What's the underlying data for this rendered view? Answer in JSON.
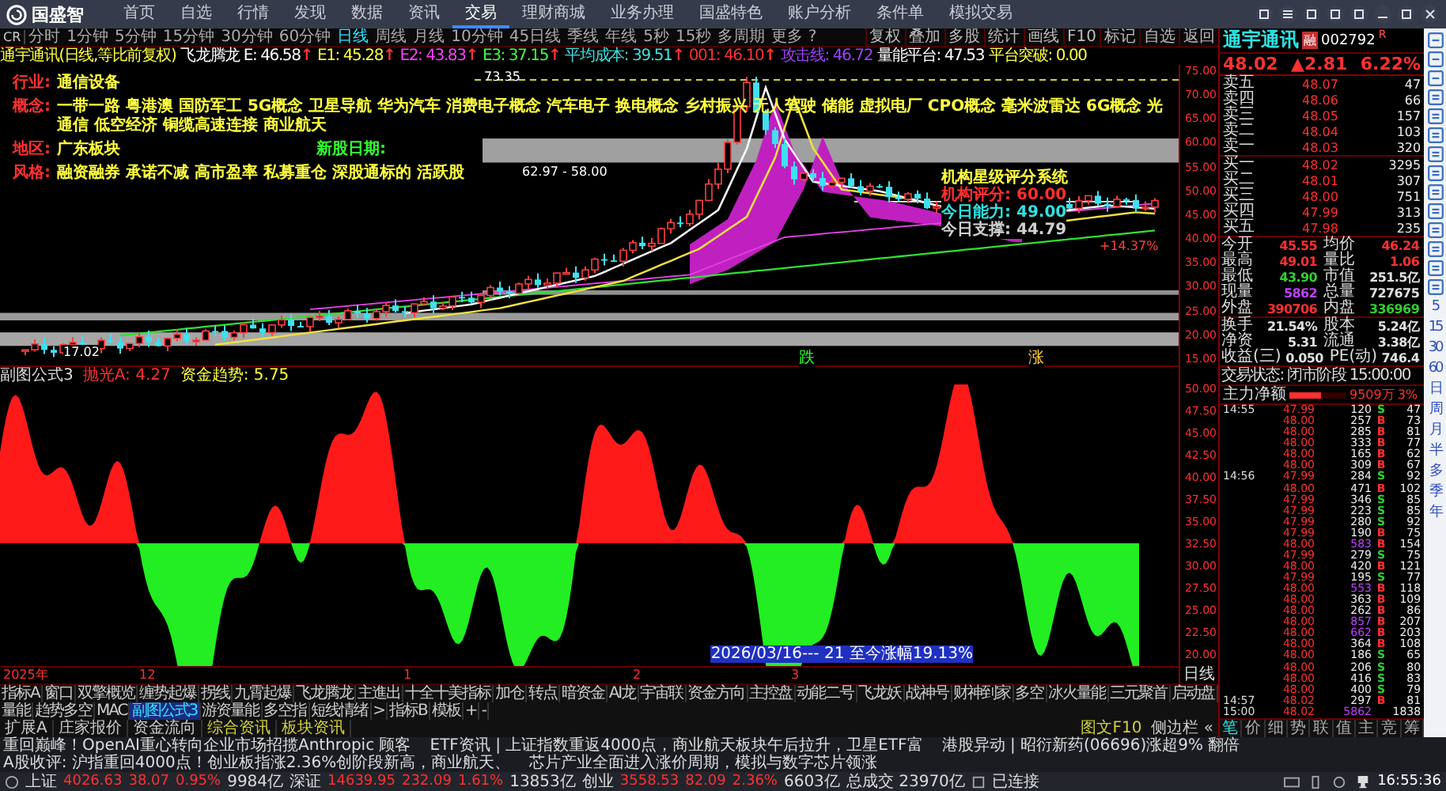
{
  "app": {
    "logo": "国盛智",
    "menu": [
      {
        "label": "首页",
        "selected": false
      },
      {
        "label": "自选",
        "selected": false
      },
      {
        "label": "行情",
        "selected": false
      },
      {
        "label": "发现",
        "selected": false
      },
      {
        "label": "数据",
        "selected": false
      },
      {
        "label": "资讯",
        "selected": false
      },
      {
        "label": "交易",
        "selected": true
      },
      {
        "label": "理财商城",
        "selected": false
      },
      {
        "label": "业务办理",
        "selected": false
      },
      {
        "label": "国盛特色",
        "selected": false
      },
      {
        "label": "账户分析",
        "selected": false
      },
      {
        "label": "条件单",
        "selected": false
      },
      {
        "label": "模拟交易",
        "selected": false
      }
    ]
  },
  "period_bar": {
    "prefix": "CR",
    "periods": [
      {
        "label": "分时",
        "selected": false
      },
      {
        "label": "1分钟",
        "selected": false
      },
      {
        "label": "5分钟",
        "selected": false
      },
      {
        "label": "15分钟",
        "selected": false
      },
      {
        "label": "30分钟",
        "selected": false
      },
      {
        "label": "60分钟",
        "selected": false
      },
      {
        "label": "日线",
        "selected": true
      },
      {
        "label": "周线",
        "selected": false
      },
      {
        "label": "月线",
        "selected": false
      },
      {
        "label": "10分钟",
        "selected": false
      },
      {
        "label": "45日线",
        "selected": false
      },
      {
        "label": "季线",
        "selected": false
      },
      {
        "label": "年线",
        "selected": false
      },
      {
        "label": "5秒",
        "selected": false
      },
      {
        "label": "15秒",
        "selected": false
      },
      {
        "label": "多周期",
        "selected": false
      },
      {
        "label": "更多 ?",
        "selected": false
      }
    ],
    "tools": [
      "复权",
      "叠加",
      "多股",
      "统计",
      "画线",
      "F10",
      "标记",
      "自选",
      "返回"
    ]
  },
  "indicator_bar": {
    "title": "通宇通讯(日线,等比前复权)",
    "items": [
      {
        "text": "飞龙腾龙 E: 46.58",
        "color": "#ffffff",
        "arrow": "↑"
      },
      {
        "text": "E1: 45.28",
        "color": "#ffff40",
        "arrow": "↑"
      },
      {
        "text": "E2: 43.83",
        "color": "#ff40ff",
        "arrow": "↑"
      },
      {
        "text": "E3: 37.15",
        "color": "#40ff40",
        "arrow": "↑"
      },
      {
        "text": "平均成本: 39.51",
        "color": "#40e0e0",
        "arrow": "↑"
      },
      {
        "text": "001: 46.10",
        "color": "#ff3030",
        "arrow": "↑"
      },
      {
        "text": "攻击线: 46.72",
        "color": "#a040ff"
      },
      {
        "text": "量能平台: 47.53",
        "color": "#ffffff"
      },
      {
        "text": "平台突破: 0.00",
        "color": "#ffff40"
      }
    ]
  },
  "info_lines": [
    {
      "label": "行业:",
      "value": "通信设备"
    },
    {
      "label": "概念:",
      "value": "一带一路 粤港澳 国防军工 5G概念 卫星导航 华为汽车 消费电子概念 汽车电子 换电概念 乡村振兴 无人驾驶 储能 虚拟电厂 CPO概念 毫米波雷达 6G概念 光通信 低空经济 铜缆高速连接 商业航天"
    },
    {
      "label": "地区:",
      "value": "广东板块",
      "extra": "新股日期:"
    },
    {
      "label": "风格:",
      "value": "融资融券 承诺不减 高市盈率 私募重仓 深股通标的 活跃股"
    }
  ],
  "rating_box": {
    "title": "机构星级评分系统",
    "lines": [
      {
        "text": "机构评分: 60.00",
        "color": "#ff3030"
      },
      {
        "text": "今日能力: 49.00",
        "color": "#30e0e0"
      },
      {
        "text": "今日支撑: 44.79",
        "color": "#d0d0d0"
      }
    ]
  },
  "chart_labels": {
    "peak": "73.35",
    "range": "62.97 - 58.00",
    "low": "17.02",
    "gain": "+14.37%",
    "fall": "跌",
    "rise": "涨"
  },
  "main_axis": [
    "75.00",
    "70.00",
    "65.00",
    "60.00",
    "55.00",
    "50.00",
    "45.00",
    "40.00",
    "35.00",
    "30.00",
    "25.00",
    "20.00",
    "15.00"
  ],
  "sub_chart": {
    "title": "副图公式3",
    "items": [
      {
        "text": "抛光A: 4.27",
        "color": "#ff3030"
      },
      {
        "text": "资金趋势: 5.75",
        "color": "#ffff40"
      }
    ]
  },
  "sub_axis": [
    "50.00",
    "47.50",
    "45.00",
    "42.50",
    "40.00",
    "37.50",
    "35.00",
    "32.50",
    "30.00",
    "27.50",
    "25.00",
    "22.50",
    "20.00"
  ],
  "axis_period": "日线",
  "time_axis": [
    "2025年",
    "12",
    "1",
    "2",
    "3"
  ],
  "range_note": "2026/03/16--- 21 至今涨幅19.13%",
  "indicator_tabs": [
    {
      "label": "指标A",
      "selected": false
    },
    {
      "label": "窗口",
      "selected": false
    },
    {
      "label": "双擎概览",
      "selected": false
    },
    {
      "label": "缠势起爆",
      "selected": false
    },
    {
      "label": "拐线",
      "selected": false
    },
    {
      "label": "九霄起爆",
      "selected": false
    },
    {
      "label": "飞龙腾龙",
      "selected": false
    },
    {
      "label": "主進出",
      "selected": false
    },
    {
      "label": "十全十美指标",
      "selected": false
    },
    {
      "label": "加仓",
      "selected": false
    },
    {
      "label": "转点",
      "selected": false
    },
    {
      "label": "暗资金",
      "selected": false
    },
    {
      "label": "AI龙",
      "selected": false
    },
    {
      "label": "宇宙联",
      "selected": false
    },
    {
      "label": "资金方向",
      "selected": false
    },
    {
      "label": "主控盘",
      "selected": false
    },
    {
      "label": "动能二号",
      "selected": false
    },
    {
      "label": "飞龙妖",
      "selected": false
    },
    {
      "label": "战神号",
      "selected": false
    },
    {
      "label": "财神到家",
      "selected": false
    },
    {
      "label": "多空",
      "selected": false
    },
    {
      "label": "冰火量能",
      "selected": false
    },
    {
      "label": "三元聚首",
      "selected": false
    },
    {
      "label": "启动盘",
      "selected": false
    },
    {
      "label": "量能",
      "selected": false
    },
    {
      "label": "趋势多空",
      "selected": false
    },
    {
      "label": "MAC",
      "selected": false
    },
    {
      "label": "副图公式3",
      "selected": true
    },
    {
      "label": "游资量能",
      "selected": false
    },
    {
      "label": "多空指",
      "selected": false
    },
    {
      "label": "短线情绪",
      "selected": false
    },
    {
      "label": ">",
      "selected": false
    },
    {
      "label": "指标B",
      "selected": false
    },
    {
      "label": "模板",
      "selected": false
    },
    {
      "label": "+",
      "selected": false
    },
    {
      "label": "-",
      "selected": false
    }
  ],
  "extra_tabs": [
    {
      "label": "扩展A",
      "highlight": false
    },
    {
      "label": "庄家报价",
      "highlight": false
    },
    {
      "label": "资金流向",
      "highlight": false
    },
    {
      "label": "综合资讯",
      "highlight": true
    },
    {
      "label": "板块资讯",
      "highlight": true
    }
  ],
  "side_links": [
    "图文F10",
    "侧边栏 «"
  ],
  "quote": {
    "name": "通宇通讯",
    "badge": "融",
    "code": "002792",
    "mark": "R",
    "price": "48.02",
    "change": "▲2.81",
    "pct": "6.22%",
    "asks": [
      {
        "label": "卖五",
        "price": "48.07",
        "volume": "47"
      },
      {
        "label": "卖四",
        "price": "48.06",
        "volume": "66"
      },
      {
        "label": "卖三",
        "price": "48.05",
        "volume": "157"
      },
      {
        "label": "卖二",
        "price": "48.04",
        "volume": "103"
      },
      {
        "label": "卖一",
        "price": "48.03",
        "volume": "320"
      }
    ],
    "bids": [
      {
        "label": "买一",
        "price": "48.02",
        "volume": "3295"
      },
      {
        "label": "买二",
        "price": "48.01",
        "volume": "307"
      },
      {
        "label": "买三",
        "price": "48.00",
        "volume": "751"
      },
      {
        "label": "买四",
        "price": "47.99",
        "volume": "313"
      },
      {
        "label": "买五",
        "price": "47.98",
        "volume": "235"
      }
    ],
    "stats": [
      [
        {
          "label": "今开",
          "value": "45.55",
          "color": "#ff3030"
        },
        {
          "label": "均价",
          "value": "46.24",
          "color": "#ff3030"
        }
      ],
      [
        {
          "label": "最高",
          "value": "49.01",
          "color": "#ff3030"
        },
        {
          "label": "量比",
          "value": "1.06",
          "color": "#ff3030"
        }
      ],
      [
        {
          "label": "最低",
          "value": "43.90",
          "color": "#30d030"
        },
        {
          "label": "市值",
          "value": "251.5亿",
          "color": "#e0e0e0"
        }
      ],
      [
        {
          "label": "现量",
          "value": "5862",
          "color": "#c040ff"
        },
        {
          "label": "总量",
          "value": "727675",
          "color": "#e0e0e0"
        }
      ],
      [
        {
          "label": "外盘",
          "value": "390706",
          "color": "#ff3030"
        },
        {
          "label": "内盘",
          "value": "336969",
          "color": "#30d030"
        }
      ]
    ],
    "stats2": [
      [
        {
          "label": "换手",
          "value": "21.54%",
          "color": "#e0e0e0"
        },
        {
          "label": "股本",
          "value": "5.24亿",
          "color": "#e0e0e0"
        }
      ],
      [
        {
          "label": "净资",
          "value": "5.31",
          "color": "#e0e0e0"
        },
        {
          "label": "流通",
          "value": "3.38亿",
          "color": "#e0e0e0"
        }
      ],
      [
        {
          "label": "收益(三)",
          "value": "0.050",
          "color": "#e0e0e0"
        },
        {
          "label": "PE(动)",
          "value": "746.4",
          "color": "#e0e0e0"
        }
      ]
    ],
    "state": "交易状态: 闭市阶段 15:00:00",
    "net": {
      "label": "主力净额",
      "amount": "9509万",
      "pct": "3%",
      "level": 0.55
    }
  },
  "ticks": [
    {
      "time": "14:55",
      "price": "47.99",
      "volume": "120",
      "side": "S",
      "count": "47",
      "kind": "sell",
      "big": false
    },
    {
      "price": "48.00",
      "volume": "257",
      "side": "B",
      "count": "73",
      "kind": "buy",
      "big": false
    },
    {
      "price": "48.00",
      "volume": "285",
      "side": "B",
      "count": "81",
      "kind": "buy",
      "big": false
    },
    {
      "price": "48.00",
      "volume": "333",
      "side": "B",
      "count": "77",
      "kind": "buy",
      "big": false
    },
    {
      "price": "48.00",
      "volume": "165",
      "side": "B",
      "count": "62",
      "kind": "buy",
      "big": false
    },
    {
      "price": "48.00",
      "volume": "309",
      "side": "B",
      "count": "67",
      "kind": "buy",
      "big": false
    },
    {
      "time": "14:56",
      "price": "47.99",
      "volume": "284",
      "side": "S",
      "count": "92",
      "kind": "sell",
      "big": false
    },
    {
      "price": "48.00",
      "volume": "471",
      "side": "B",
      "count": "102",
      "kind": "buy",
      "big": false
    },
    {
      "price": "47.99",
      "volume": "346",
      "side": "S",
      "count": "85",
      "kind": "sell",
      "big": false
    },
    {
      "price": "47.99",
      "volume": "223",
      "side": "S",
      "count": "85",
      "kind": "sell",
      "big": false
    },
    {
      "price": "47.99",
      "volume": "280",
      "side": "S",
      "count": "92",
      "kind": "sell",
      "big": false
    },
    {
      "price": "47.99",
      "volume": "190",
      "side": "B",
      "count": "75",
      "kind": "buy",
      "big": false
    },
    {
      "price": "48.00",
      "volume": "583",
      "side": "B",
      "count": "154",
      "kind": "buy",
      "big": true
    },
    {
      "price": "47.99",
      "volume": "279",
      "side": "S",
      "count": "75",
      "kind": "sell",
      "big": false
    },
    {
      "price": "48.00",
      "volume": "420",
      "side": "B",
      "count": "121",
      "kind": "buy",
      "big": false
    },
    {
      "price": "47.99",
      "volume": "195",
      "side": "S",
      "count": "77",
      "kind": "sell",
      "big": false
    },
    {
      "price": "48.00",
      "volume": "553",
      "side": "B",
      "count": "118",
      "kind": "buy",
      "big": true
    },
    {
      "price": "48.00",
      "volume": "363",
      "side": "B",
      "count": "109",
      "kind": "buy",
      "big": false
    },
    {
      "price": "48.00",
      "volume": "262",
      "side": "B",
      "count": "86",
      "kind": "buy",
      "big": false
    },
    {
      "price": "48.00",
      "volume": "857",
      "side": "B",
      "count": "207",
      "kind": "buy",
      "big": true
    },
    {
      "price": "48.00",
      "volume": "662",
      "side": "B",
      "count": "203",
      "kind": "buy",
      "big": true
    },
    {
      "price": "48.00",
      "volume": "364",
      "side": "B",
      "count": "108",
      "kind": "buy",
      "big": false
    },
    {
      "price": "48.00",
      "volume": "186",
      "side": "S",
      "count": "65",
      "kind": "sell",
      "big": false
    },
    {
      "price": "48.00",
      "volume": "206",
      "side": "S",
      "count": "80",
      "kind": "sell",
      "big": false
    },
    {
      "price": "48.00",
      "volume": "416",
      "side": "S",
      "count": "83",
      "kind": "sell",
      "big": false
    },
    {
      "price": "48.00",
      "volume": "400",
      "side": "S",
      "count": "79",
      "kind": "sell",
      "big": false
    },
    {
      "time": "14:57",
      "price": "48.02",
      "volume": "297",
      "side": "B",
      "count": "81",
      "kind": "buy",
      "big": false
    },
    {
      "time": "15:00",
      "price": "48.02",
      "volume": "5862",
      "count": "1838",
      "kind": "none",
      "big": true
    }
  ],
  "quote_tabs": [
    {
      "label": "笔",
      "selected": true
    },
    {
      "label": "价",
      "selected": false
    },
    {
      "label": "细",
      "selected": false
    },
    {
      "label": "势",
      "selected": false
    },
    {
      "label": "联",
      "selected": false
    },
    {
      "label": "值",
      "selected": false
    },
    {
      "label": "主",
      "selected": false
    },
    {
      "label": "竞",
      "selected": false
    },
    {
      "label": "筹",
      "selected": false
    }
  ],
  "period_strip": [
    "5",
    "15",
    "30",
    "60",
    "日",
    "周",
    "月",
    "半",
    "多",
    "季",
    "年"
  ],
  "ticker": [
    "重回巅峰！OpenAI重心转向企业市场招揽Anthropic 顾客",
    "ETF资讯 | 上证指数重返4000点，商业航天板块午后拉升，卫星ETF富",
    "港股异动 | 昭衍新药(06696)涨超9% 翻倍",
    "A股收评: 沪指重回4000点！创业板指涨2.36%创阶段新高，商业航天、",
    "芯片产业全面进入涨价周期，模拟与数字芯片领涨"
  ],
  "status_bar": {
    "indices": [
      {
        "name": "上证",
        "value": "4026.63",
        "change": "38.07",
        "pct": "0.95%",
        "amount": "9984亿"
      },
      {
        "name": "深证",
        "value": "14639.95",
        "change": "232.09",
        "pct": "1.61%",
        "amount": "13853亿"
      },
      {
        "name": "创业",
        "value": "3558.53",
        "change": "82.09",
        "pct": "2.36%",
        "amount": "6603亿"
      }
    ],
    "total": "总成交 23970亿",
    "connection": "已连接",
    "clock": "16:55:36"
  }
}
